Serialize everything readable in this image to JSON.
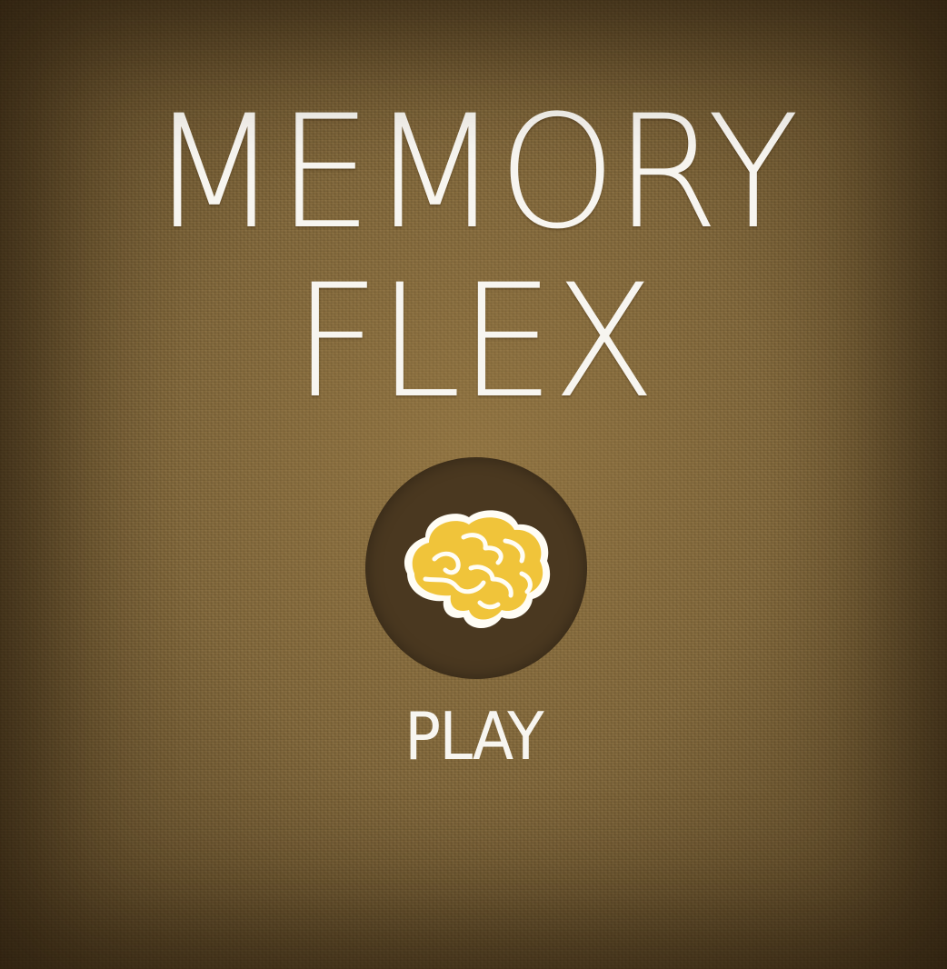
{
  "title": {
    "line1": "MEMORY",
    "line2": "FLEX"
  },
  "play": {
    "label": "PLAY",
    "icon": "brain-icon"
  },
  "colors": {
    "background": "#84693a",
    "title_text": "#f7f5f0",
    "button_circle": "#4a3820",
    "brain_fill": "#f0c43a",
    "brain_outline": "#fffdf5"
  }
}
